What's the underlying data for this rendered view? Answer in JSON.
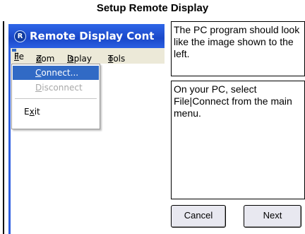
{
  "dialog": {
    "title": "Setup Remote Display"
  },
  "screenshot": {
    "app_icon": "remote-display-logo-icon",
    "app_icon_glyph": "R",
    "window_title": "Remote Display Cont",
    "menu": {
      "file": {
        "first": "F",
        "rest": "ile"
      },
      "zoom": {
        "first": "Z",
        "rest": "oom"
      },
      "display": {
        "first": "D",
        "rest": "isplay"
      },
      "tools": {
        "first": "T",
        "rest": "ools"
      }
    },
    "dropdown": {
      "connect": {
        "first": "C",
        "rest": "onnect..."
      },
      "disconnect": {
        "first": "D",
        "rest": "isconnect"
      },
      "exit": {
        "first": "E",
        "mid": "x",
        "rest": "it"
      }
    }
  },
  "instructions": {
    "top": "The PC program should look like the image shown to the left.",
    "bottom": "On your PC, select File|Connect from the main menu."
  },
  "buttons": {
    "cancel": "Cancel",
    "next": "Next"
  },
  "colors": {
    "titlebar": "#1a48c9",
    "highlight": "#316ac5",
    "menubar": "#ece9d8"
  }
}
